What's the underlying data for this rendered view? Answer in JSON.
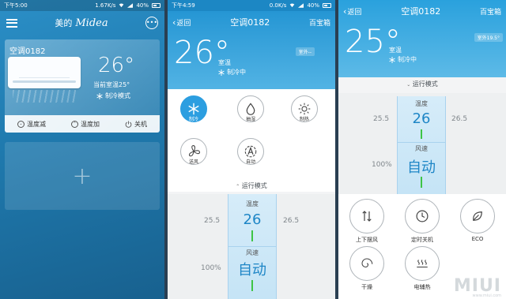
{
  "screen1": {
    "status": {
      "time": "下午5:00",
      "speed": "1.67K/s",
      "battery": "40%"
    },
    "brand": "美的",
    "brand_logo": "Midea",
    "more_icon": "•••",
    "device": {
      "name": "空调0182",
      "temp": "26°",
      "room_temp": "当前室温25°",
      "mode": "制冷模式",
      "actions": [
        {
          "label": "温度减",
          "icon": "chevron-down-icon"
        },
        {
          "label": "温度加",
          "icon": "chevron-up-icon"
        },
        {
          "label": "关机",
          "icon": "power-icon"
        }
      ]
    },
    "add_symbol": "+"
  },
  "screen2": {
    "status": {
      "time": "下午4:59",
      "speed": "0.0K/s",
      "battery": "40%"
    },
    "back_label": "返回",
    "title": "空调0182",
    "toolbox_label": "百宝箱",
    "temp": "26°",
    "sub_label": "室温",
    "mode_text": "制冷中",
    "outdoor_badge": "室外--",
    "modes": [
      {
        "label": "制冷",
        "icon": "snowflake-icon",
        "active": true
      },
      {
        "label": "抽湿",
        "icon": "droplet-icon",
        "active": false
      },
      {
        "label": "制热",
        "icon": "sun-icon",
        "active": false
      },
      {
        "label": "送风",
        "icon": "fan-icon",
        "active": false
      },
      {
        "label": "自动",
        "icon": "auto-icon",
        "active": false
      }
    ],
    "mode_toggle": "运行模式",
    "temp_control": {
      "label": "温度",
      "prev": "25.5",
      "value": "26",
      "next": "26.5"
    },
    "fan_control": {
      "label": "风速",
      "prev": "100%",
      "value": "自动"
    }
  },
  "screen3": {
    "back_label": "返回",
    "title": "空调0182",
    "toolbox_label": "百宝箱",
    "temp": "25°",
    "sub_label": "室温",
    "mode_text": "制冷中",
    "outdoor_badge": "室外19.5°",
    "mode_toggle": "运行模式",
    "temp_control": {
      "label": "温度",
      "prev": "25.5",
      "value": "26",
      "next": "26.5"
    },
    "fan_control": {
      "label": "风速",
      "prev": "100%",
      "value": "自动"
    },
    "functions": [
      {
        "label": "上下摆风",
        "icon": "swing-icon"
      },
      {
        "label": "定时关机",
        "icon": "clock-icon"
      },
      {
        "label": "ECO",
        "icon": "leaf-icon"
      },
      {
        "label": "干燥",
        "icon": "spiral-icon"
      },
      {
        "label": "电辅热",
        "icon": "heat-icon"
      }
    ],
    "watermark": "MIUI",
    "watermark_sub": "www.miui.com"
  },
  "colors": {
    "accent": "#2c9ee0",
    "header": "#2596d4",
    "highlight": "#3ec445"
  }
}
